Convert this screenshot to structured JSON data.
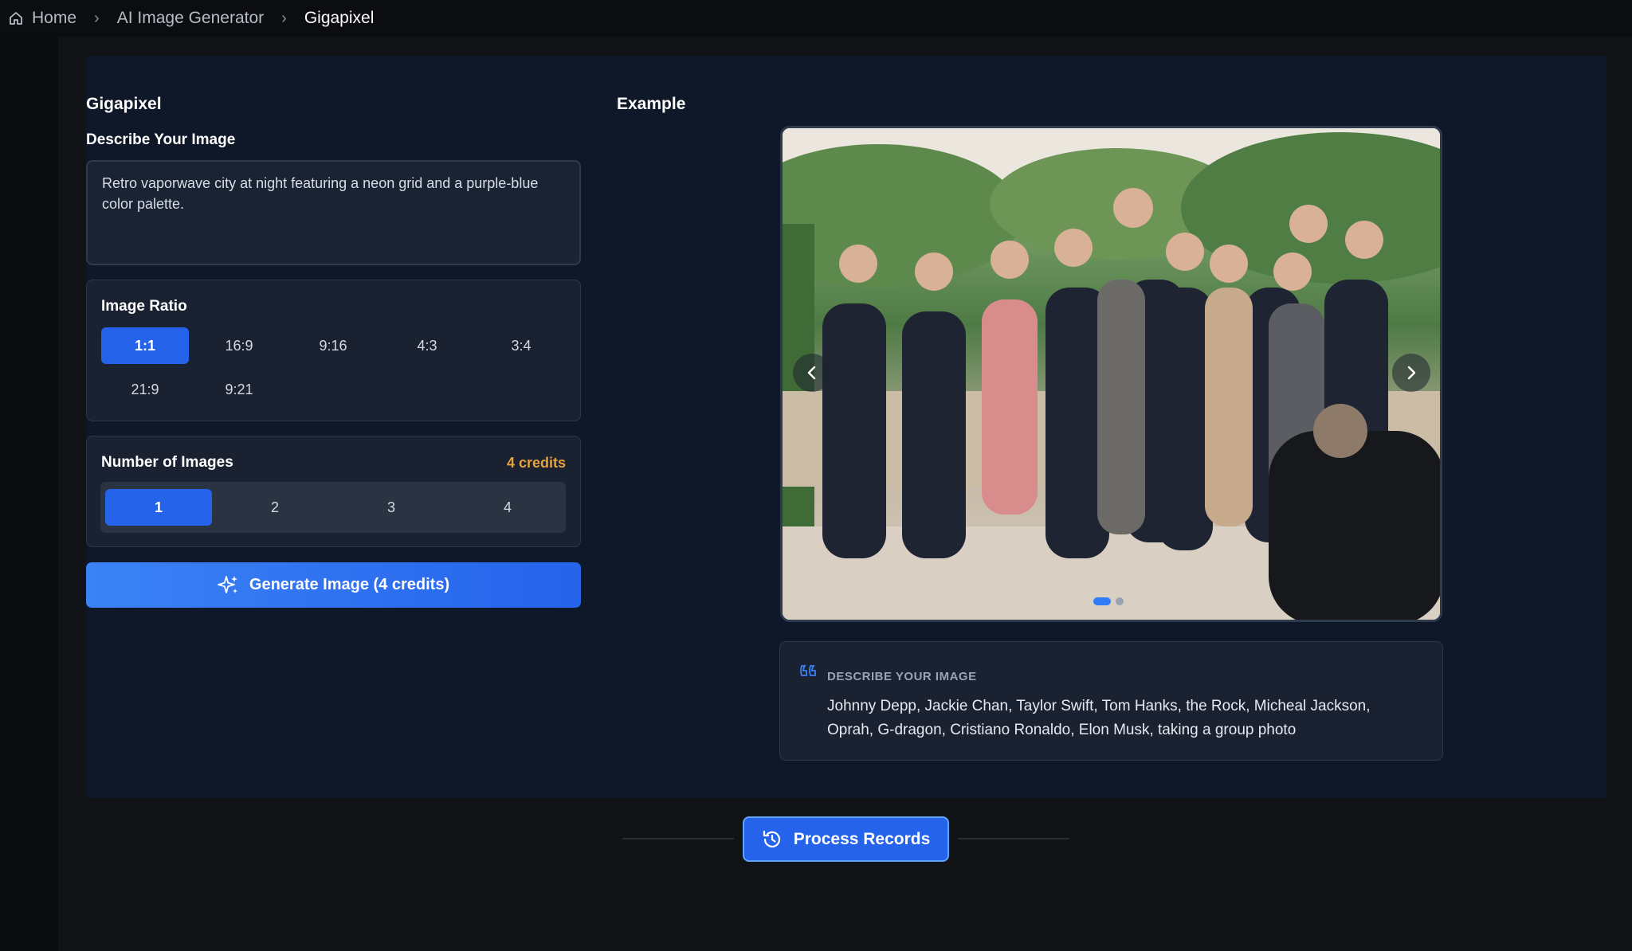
{
  "breadcrumb": {
    "home": "Home",
    "section": "AI Image Generator",
    "current": "Gigapixel"
  },
  "form": {
    "title": "Gigapixel",
    "describe_label": "Describe Your Image",
    "prompt_value": "Retro vaporwave city at night featuring a neon grid and a purple-blue color palette.",
    "ratio": {
      "label": "Image Ratio",
      "options": [
        "1:1",
        "16:9",
        "9:16",
        "4:3",
        "3:4",
        "21:9",
        "9:21"
      ],
      "selected": "1:1"
    },
    "count": {
      "label": "Number of Images",
      "credits": "4 credits",
      "options": [
        "1",
        "2",
        "3",
        "4"
      ],
      "selected": "1"
    },
    "generate_label": "Generate Image (4 credits)"
  },
  "example": {
    "title": "Example",
    "carousel": {
      "slides": 2,
      "active_index": 0
    },
    "describe_label": "DESCRIBE YOUR IMAGE",
    "describe_text": "Johnny Depp, Jackie Chan, Taylor Swift, Tom Hanks, the Rock, Micheal Jackson, Oprah, G-dragon, Cristiano Ronaldo, Elon Musk, taking a group photo"
  },
  "footer": {
    "process_records_label": "Process Records"
  },
  "colors": {
    "accent": "#2563eb",
    "credits": "#e6a23c",
    "panel": "#0e1828"
  }
}
